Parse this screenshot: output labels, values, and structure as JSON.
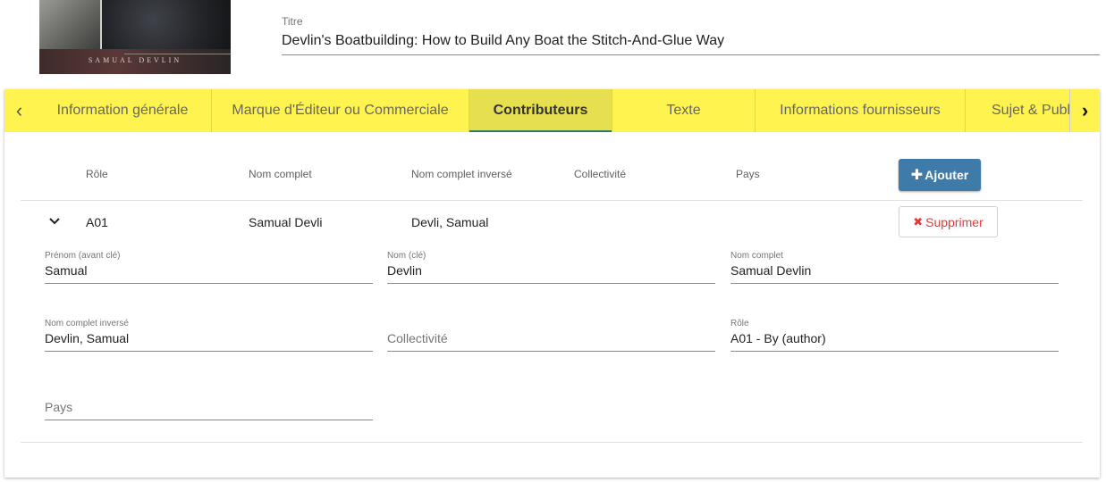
{
  "book": {
    "cover_author": "SAMUAL DEVLIN",
    "title_label": "Titre",
    "title_value": "Devlin's Boatbuilding: How to Build Any Boat the Stitch-And-Glue Way"
  },
  "tabs": [
    {
      "label": "Information générale"
    },
    {
      "label": "Marque d'Éditeur ou Commerciale"
    },
    {
      "label": "Contributeurs"
    },
    {
      "label": "Texte"
    },
    {
      "label": "Informations fournisseurs"
    },
    {
      "label": "Sujet & Public"
    }
  ],
  "table": {
    "columns": [
      "Rôle",
      "Nom complet",
      "Nom complet inversé",
      "Collectivité",
      "Pays"
    ],
    "add_label": "Ajouter",
    "rows": [
      {
        "role": "A01",
        "full_name": "Samual Devli",
        "inverted_name": "Devli, Samual",
        "corporate": "",
        "country": "",
        "delete_label": "Supprimer"
      }
    ]
  },
  "detail": {
    "first_name": {
      "label": "Prénom (avant clé)",
      "value": "Samual"
    },
    "last_name": {
      "label": "Nom (clé)",
      "value": "Devlin"
    },
    "full_name": {
      "label": "Nom complet",
      "value": "Samual Devlin"
    },
    "inverted_name": {
      "label": "Nom complet inversé",
      "value": "Devlin, Samual"
    },
    "corporate": {
      "placeholder": "Collectivité"
    },
    "role": {
      "label": "Rôle",
      "value": "A01 - By (author)"
    },
    "country": {
      "placeholder": "Pays"
    }
  }
}
